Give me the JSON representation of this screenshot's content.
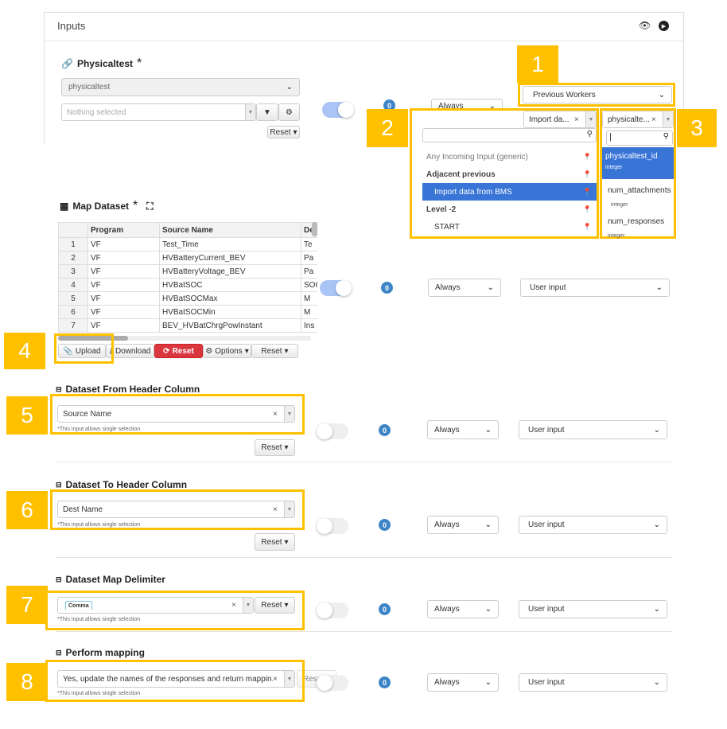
{
  "header": {
    "title": "Inputs"
  },
  "physicaltest": {
    "title": "Physicaltest",
    "required": "*",
    "source_select": "physicaltest",
    "filter_placeholder": "Nothing selected",
    "reset": "Reset",
    "badge": "0",
    "when": "Always",
    "origin": "Previous Workers"
  },
  "incoming_dropdown": {
    "chip": "Import da...",
    "items": [
      {
        "label": "Any Incoming Input (generic)",
        "style": "normal"
      },
      {
        "label": "Adjacent previous",
        "style": "group"
      },
      {
        "label": "Import data from BMS",
        "style": "selected"
      },
      {
        "label": "Level -2",
        "style": "group"
      },
      {
        "label": "START",
        "style": "item"
      }
    ]
  },
  "field_dropdown": {
    "chip": "physicalte...",
    "items": [
      {
        "label": "physicaltest_id",
        "type": "integer"
      },
      {
        "label": "num_attachments",
        "type": "integer"
      },
      {
        "label": "num_responses",
        "type": "integer"
      }
    ]
  },
  "map_dataset": {
    "title": "Map Dataset",
    "required": "*",
    "columns": [
      "",
      "Program",
      "Source Name",
      "De"
    ],
    "rows": [
      [
        "1",
        "VF",
        "Test_Time",
        "Te"
      ],
      [
        "2",
        "VF",
        "HVBatteryCurrent_BEV",
        "Pa"
      ],
      [
        "3",
        "VF",
        "HVBatteryVoltage_BEV",
        "Pa"
      ],
      [
        "4",
        "VF",
        "HVBatSOC",
        "SOC"
      ],
      [
        "5",
        "VF",
        "HVBatSOCMax",
        "M"
      ],
      [
        "6",
        "VF",
        "HVBatSOCMin",
        "M"
      ],
      [
        "7",
        "VF",
        "BEV_HVBatChrgPowInstant",
        "Ins"
      ]
    ],
    "buttons": {
      "upload": "Upload",
      "download": "Download",
      "reset_red": "Reset",
      "options": "Options",
      "reset": "Reset"
    },
    "badge": "0",
    "when": "Always",
    "origin": "User input"
  },
  "sections": [
    {
      "title": "Dataset From Header Column",
      "value": "Source Name",
      "note": "*This input allows single selection",
      "reset": "Reset",
      "badge": "0",
      "when": "Always",
      "origin": "User input"
    },
    {
      "title": "Dataset To Header Column",
      "value": "Dest Name",
      "note": "*This input allows single selection",
      "reset": "Reset",
      "badge": "0",
      "when": "Always",
      "origin": "User input"
    },
    {
      "title": "Dataset Map Delimiter",
      "value": "Comma",
      "note": "*This input allows single selection",
      "reset": "Reset",
      "badge": "0",
      "when": "Always",
      "origin": "User input"
    },
    {
      "title": "Perform mapping",
      "value": "Yes, update the names of the responses and return mappin...",
      "note": "*This input allows single selection",
      "reset": "Reset",
      "badge": "0",
      "when": "Always",
      "origin": "User input"
    }
  ],
  "annotations": [
    "1",
    "2",
    "3",
    "4",
    "5",
    "6",
    "7",
    "8"
  ],
  "colors": {
    "highlight": "#ffc000",
    "selected": "#3875d7",
    "badge": "#3d85c6",
    "reset_red": "#d9363e",
    "toggle_on": "#a9c4f5"
  }
}
